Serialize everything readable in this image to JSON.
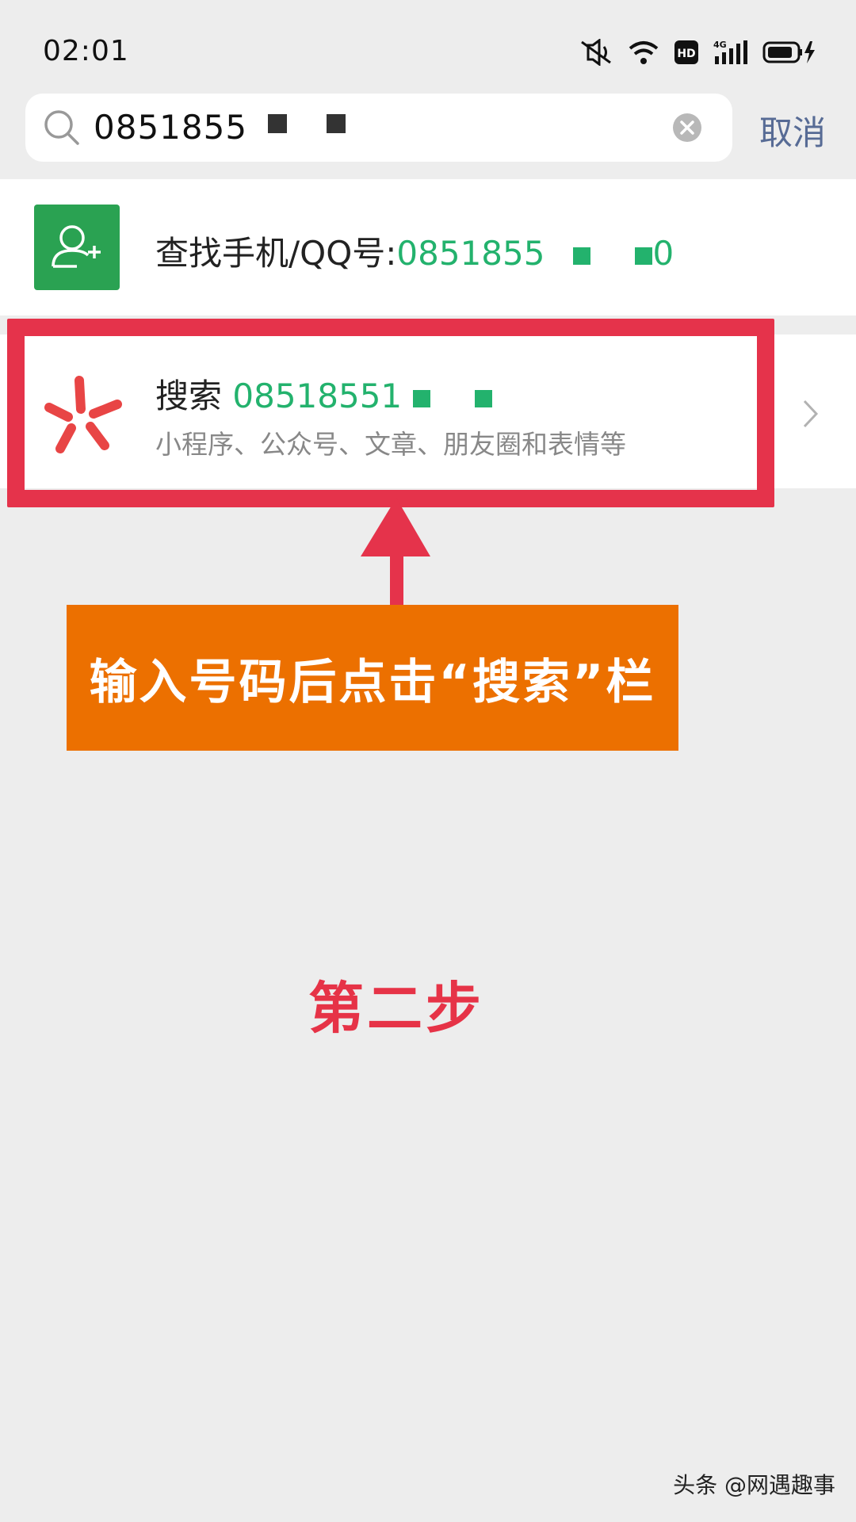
{
  "status_bar": {
    "time": "02:01",
    "icons": [
      "mute-icon",
      "wifi-icon",
      "hd-icon",
      "4g-signal-icon",
      "battery-charging-icon"
    ],
    "hd_label": "HD",
    "network_label": "4G"
  },
  "search": {
    "value": "0851855",
    "cancel_label": "取消"
  },
  "results": {
    "find_contact": {
      "label": "查找手机/QQ号:",
      "number": "0851855",
      "number_tail": "0"
    },
    "search_one": {
      "title": "搜索",
      "number": "08518551",
      "subtitle": "小程序、公众号、文章、朋友圈和表情等"
    }
  },
  "annotation": {
    "callout": "输入号码后点击“搜索”栏",
    "step": "第二步"
  },
  "watermark": "头条 @网遇趣事",
  "colors": {
    "accent_green": "#23b26d",
    "link_blue": "#576b95",
    "highlight_red": "#e5334b",
    "callout_orange": "#ec7000"
  }
}
